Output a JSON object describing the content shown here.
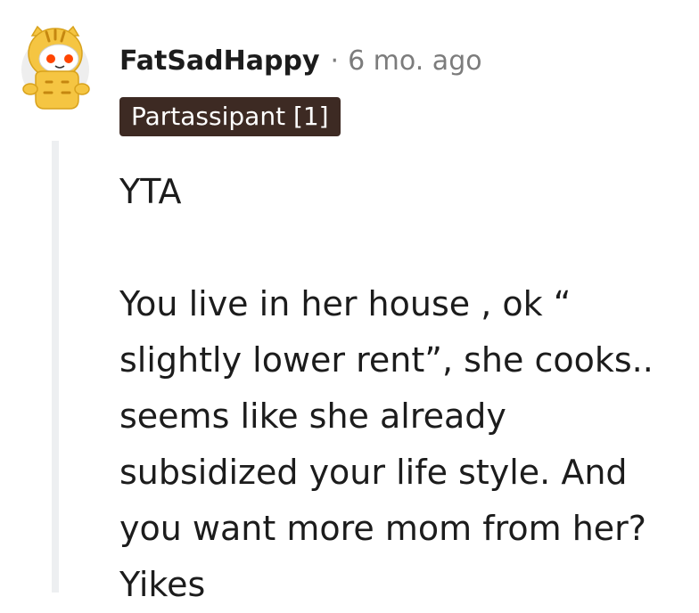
{
  "comment": {
    "username": "FatSadHappy",
    "separator": "·",
    "timestamp": "6 mo. ago",
    "flair": "Partassipant [1]",
    "avatar_icon": "snoo-tiger-avatar-icon",
    "body": {
      "verdict": "YTA",
      "lines": [
        "You live in her house , ok “",
        "slightly lower rent”, she cooks..",
        "seems like she already",
        "subsidized your life style. And",
        "you want more mom from her?",
        "Yikes"
      ]
    }
  },
  "colors": {
    "flair_bg": "#3d2a23",
    "flair_text": "#ffffff",
    "meta_gray": "#7c7c7c",
    "thread_line": "#edeff1",
    "text": "#1c1c1c"
  }
}
